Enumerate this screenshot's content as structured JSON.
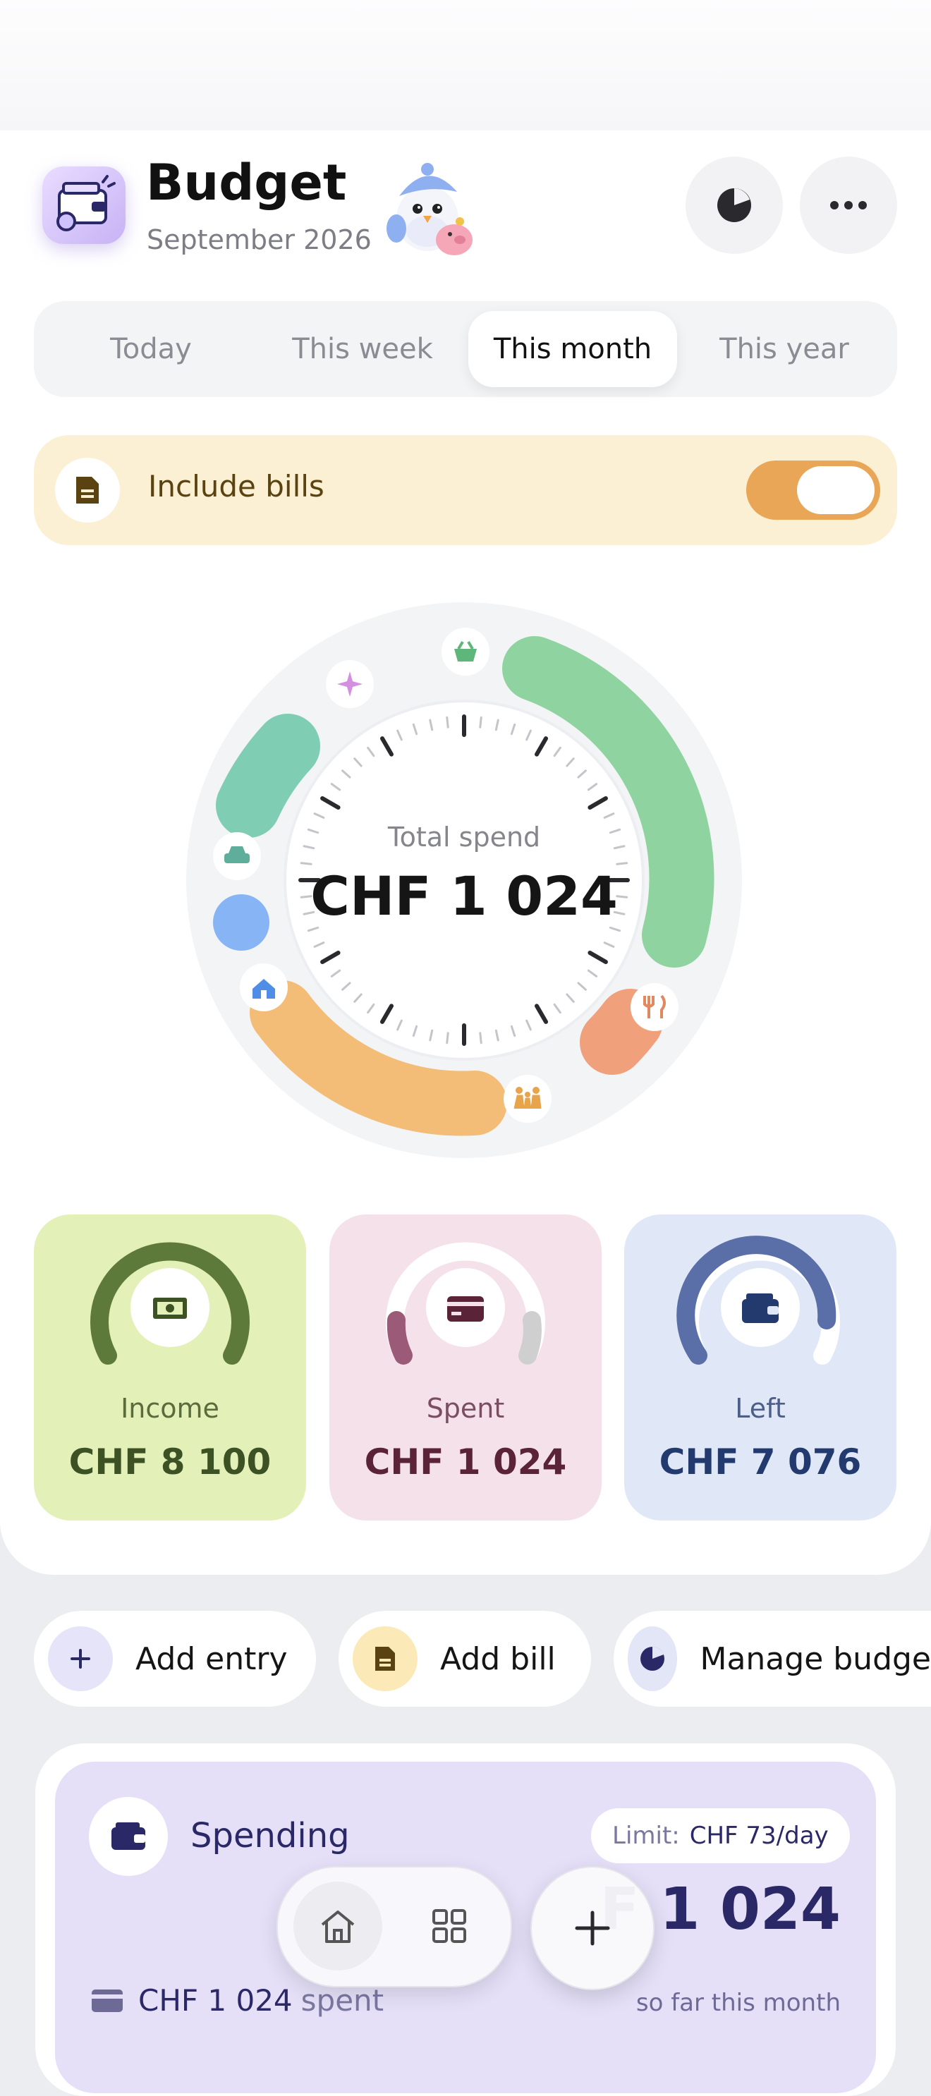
{
  "header": {
    "title": "Budget",
    "subtitle": "September 2026",
    "icons": [
      "wallet-app-icon",
      "pie-chart-icon",
      "more-icon"
    ]
  },
  "tabs": [
    {
      "label": "Today",
      "active": false
    },
    {
      "label": "This week",
      "active": false
    },
    {
      "label": "This month",
      "active": true
    },
    {
      "label": "This year",
      "active": false
    }
  ],
  "bills_toggle": {
    "label": "Include bills",
    "on": true,
    "accent": "#e8a656"
  },
  "dial": {
    "label": "Total spend",
    "value": "CHF 1 024",
    "categories": [
      {
        "icon": "basket-icon",
        "color": "#8fd4a0"
      },
      {
        "icon": "fork-knife-icon",
        "color": "#f0a07a"
      },
      {
        "icon": "family-icon",
        "color": "#f3bd77"
      },
      {
        "icon": "home-icon",
        "color": "#86b4f5"
      },
      {
        "icon": "car-icon",
        "color": "#7fcdb2"
      },
      {
        "icon": "sparkle-icon",
        "color": "#d58fe0"
      }
    ]
  },
  "stats": [
    {
      "label": "Income",
      "value": "CHF 8 100",
      "bg": "#e3f0b8",
      "fg": "#3d5224",
      "icon": "banknote-icon"
    },
    {
      "label": "Spent",
      "value": "CHF 1 024",
      "bg": "#f5e1ea",
      "fg": "#5b2337",
      "icon": "credit-card-icon"
    },
    {
      "label": "Left",
      "value": "CHF 7 076",
      "bg": "#e0e8f8",
      "fg": "#233a6e",
      "icon": "wallet-icon"
    }
  ],
  "actions": [
    {
      "label": "Add entry",
      "icon": "plus-icon"
    },
    {
      "label": "Add bill",
      "icon": "document-icon"
    },
    {
      "label": "Manage budge",
      "icon": "pie-chart-icon"
    }
  ],
  "spending": {
    "title": "Spending",
    "limit_key": "Limit:",
    "limit_value": "CHF 73/day",
    "amount": "F 1 024",
    "caption": "so far this month",
    "spent_value": "CHF 1 024",
    "spent_word": "spent"
  },
  "nav": {
    "items": [
      "home-icon",
      "grid-icon"
    ],
    "fab": "plus-icon"
  }
}
